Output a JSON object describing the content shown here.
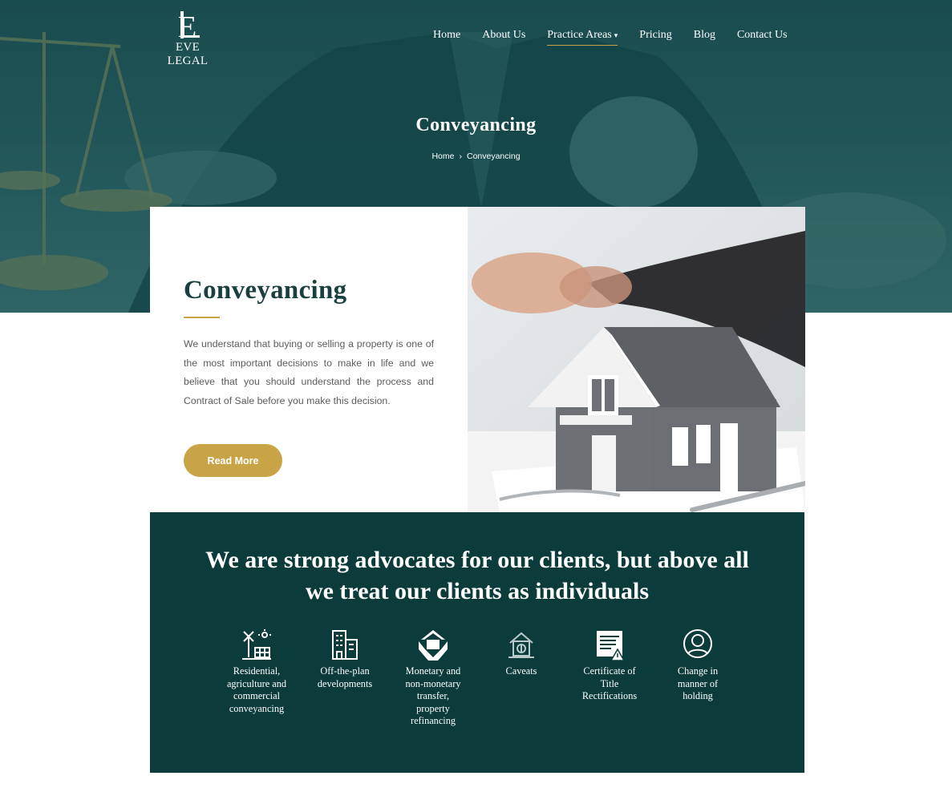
{
  "brand": {
    "logo_monogram": "EL",
    "name": "EVE LEGAL"
  },
  "nav": {
    "items": [
      {
        "label": "Home"
      },
      {
        "label": "About Us"
      },
      {
        "label": "Practice Areas"
      },
      {
        "label": "Pricing"
      },
      {
        "label": "Blog"
      },
      {
        "label": "Contact Us"
      }
    ],
    "active_item": "Practice Areas",
    "dropdown_caret": "▾"
  },
  "hero": {
    "title": "Conveyancing",
    "breadcrumb": {
      "home": "Home",
      "separator": "›",
      "current": "Conveyancing"
    }
  },
  "intro": {
    "title": "Conveyancing",
    "text": "We understand that buying or selling a property is one of the most important decisions to make in life and we believe that you should understand the process and Contract of Sale before you make this decision.",
    "button_label": "Read More",
    "image_subject": "house-model-and-handshake-photo"
  },
  "advocates": {
    "heading_line1": "We are strong advocates for our clients, but above all",
    "heading_line2": "we treat our clients as individuals",
    "services": [
      {
        "icon": "farm-windmill-icon",
        "lines": [
          "Residential,",
          "agriculture and",
          "commercial",
          "conveyancing"
        ]
      },
      {
        "icon": "buildings-icon",
        "lines": [
          "Off-the-plan",
          "developments"
        ]
      },
      {
        "icon": "house-in-hands-icon",
        "lines": [
          "Monetary and",
          "non-monetary",
          "transfer,",
          "property",
          "refinancing"
        ]
      },
      {
        "icon": "house-money-icon",
        "lines": [
          "Caveats"
        ]
      },
      {
        "icon": "certificate-warning-icon",
        "lines": [
          "Certificate of",
          "Title",
          "Rectifications"
        ]
      },
      {
        "icon": "person-icon",
        "lines": [
          "Change in",
          "manner of",
          "holding"
        ]
      }
    ]
  },
  "colors": {
    "hero_teal": "#1e5356",
    "dark_teal": "#0b3b3b",
    "gold": "#c9a447",
    "heading_text": "#1a3f3f",
    "body_text": "#5c5c5c",
    "white": "#ffffff"
  }
}
